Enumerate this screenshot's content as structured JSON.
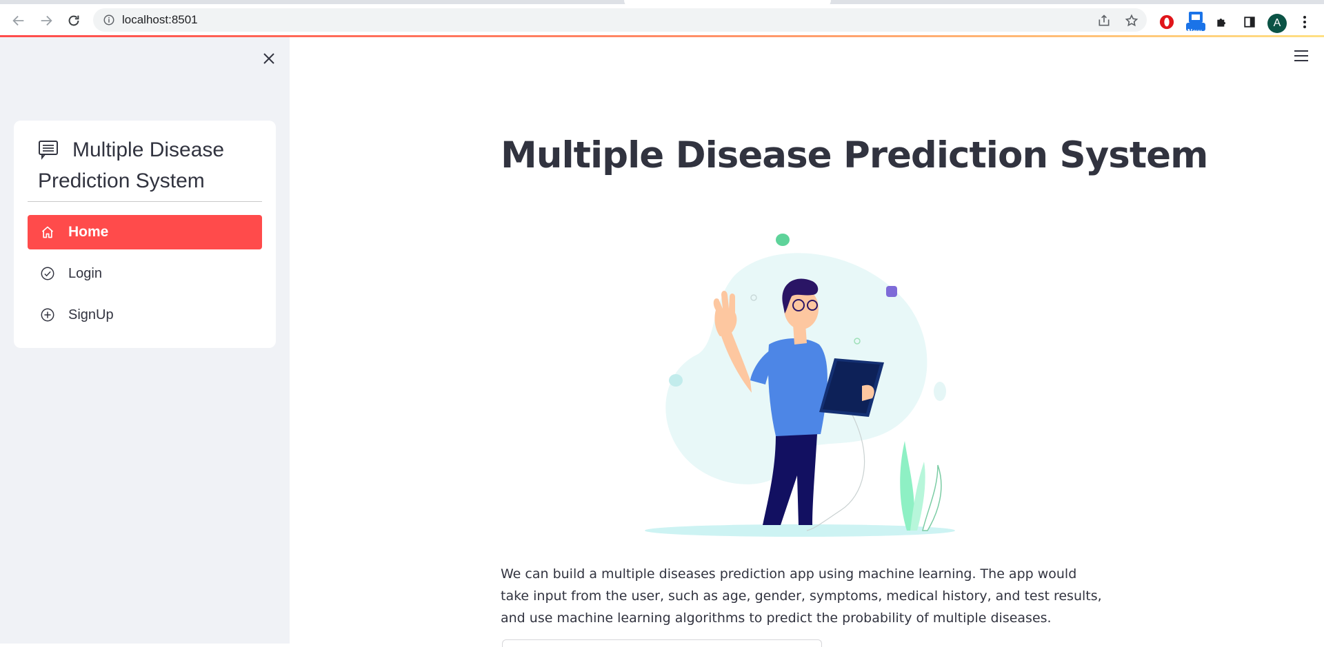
{
  "browser": {
    "url": "localhost:8501",
    "extension_badge": "New",
    "profile_initial": "A",
    "accent_color": "#ff4b4b"
  },
  "sidebar": {
    "menu_title": "Multiple Disease Prediction System",
    "menu_title_icon": "list-icon",
    "items": [
      {
        "label": "Home",
        "icon": "house-icon",
        "active": true
      },
      {
        "label": "Login",
        "icon": "check-circle-icon",
        "active": false
      },
      {
        "label": "SignUp",
        "icon": "plus-circle-icon",
        "active": false
      }
    ]
  },
  "main": {
    "title": "Multiple Disease Prediction System",
    "description": "We can build a multiple diseases prediction app using machine learning. The app would take input from the user, such as age, gender, symptoms, medical history, and test results, and use machine learning algorithms to predict the probability of multiple diseases."
  }
}
